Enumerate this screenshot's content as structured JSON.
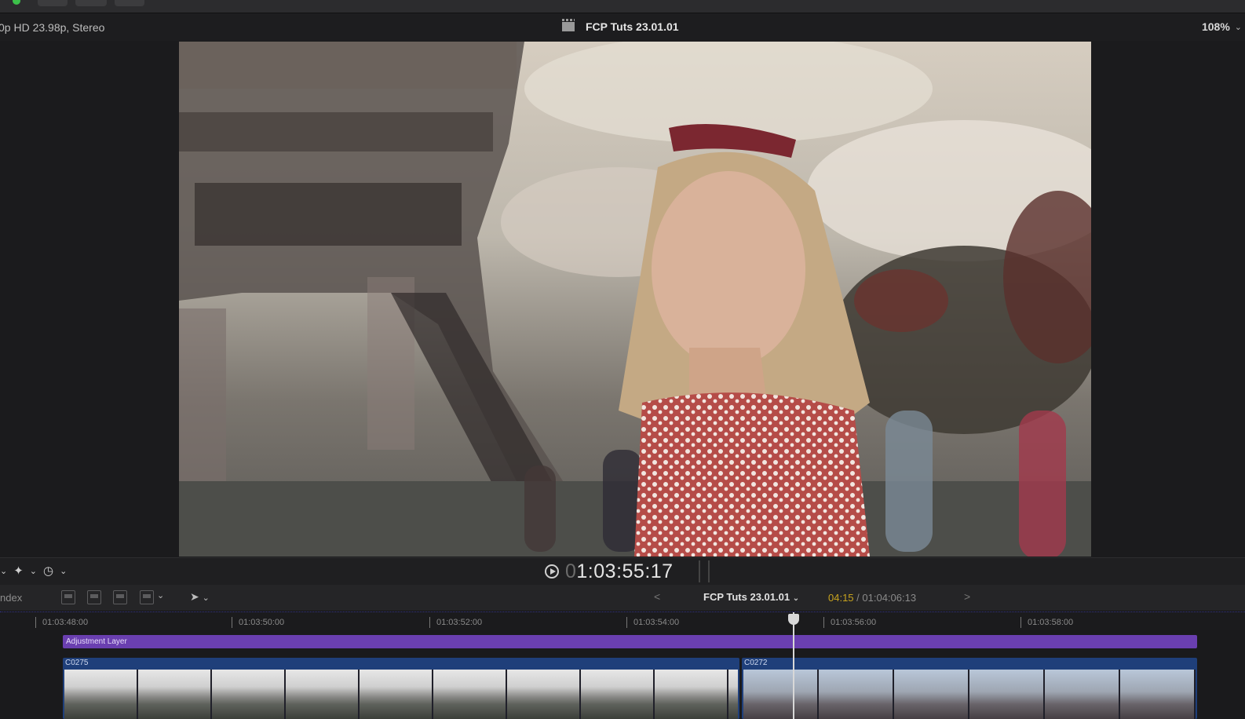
{
  "viewer": {
    "format": "0p HD 23.98p, Stereo",
    "project_title": "FCP Tuts 23.01.01",
    "zoom": "108%"
  },
  "transport": {
    "timecode_prefix": "0",
    "timecode": "1:03:55:17"
  },
  "timeline_toolbar": {
    "index_label": "ndex",
    "project_name": "FCP Tuts 23.01.01",
    "duration_current": "04:15",
    "duration_separator": " / ",
    "duration_total": "01:04:06:13"
  },
  "ruler": {
    "ticks": [
      "01:03:48:00",
      "01:03:50:00",
      "01:03:52:00",
      "01:03:54:00",
      "01:03:56:00",
      "01:03:58:00"
    ]
  },
  "tracks": {
    "adjustment_layer": "Adjustment Layer",
    "clips": [
      "C0275",
      "C0272"
    ]
  },
  "colors": {
    "adjustment_layer": "#6a3fb0",
    "clip": "#1f3f7a",
    "duration_highlight": "#c7a31e"
  },
  "icons": [
    "clapper-icon",
    "chevron-down-icon",
    "magic-wand-icon",
    "speed-icon",
    "play-icon",
    "arrow-select-icon",
    "chevron-left-icon",
    "chevron-right-icon"
  ]
}
